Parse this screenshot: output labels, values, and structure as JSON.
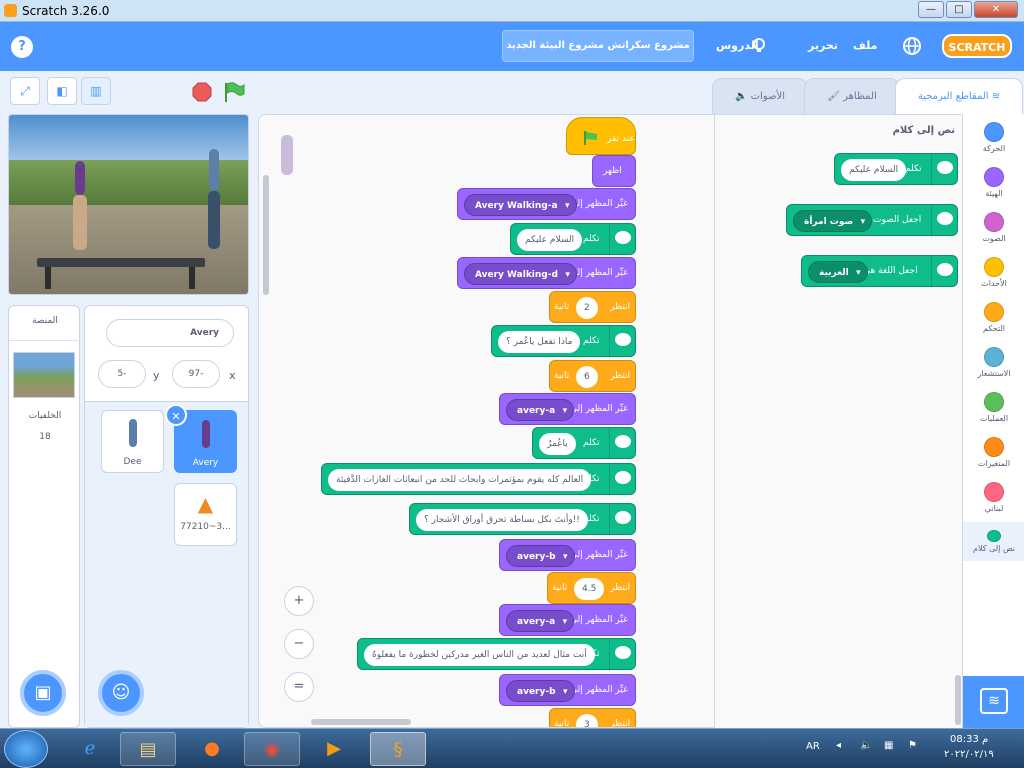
{
  "window": {
    "title": "Scratch 3.26.0",
    "minimize": "—",
    "maximize": "□",
    "close": "✕"
  },
  "menu": {
    "help": "?",
    "file": "ملف",
    "edit": "تحرير",
    "tutorials": "الدروس",
    "project_title": "مشروع سكراتش مشروع البيئة الجديد",
    "logo": "SCRATCH"
  },
  "tabs": {
    "code": "المقاطع البرمجية",
    "costumes": "المظاهر",
    "sounds": "الأصوات"
  },
  "palette": {
    "heading": "نص إلى كلام",
    "speak_label": "تكلم",
    "speak_value": "السلام عليكم",
    "voice_label": "اجعل الصوت",
    "voice_value": "صوت امرأة",
    "language_label": "اجعل اللغة هي",
    "language_value": "العربية"
  },
  "categories": [
    {
      "label": "الحركة",
      "color": "#4c97ff"
    },
    {
      "label": "الهيئة",
      "color": "#9966ff"
    },
    {
      "label": "الصوت",
      "color": "#cf63cf"
    },
    {
      "label": "الأحداث",
      "color": "#ffbf00"
    },
    {
      "label": "التحكم",
      "color": "#ffab19"
    },
    {
      "label": "الاستشعار",
      "color": "#5cb1d6"
    },
    {
      "label": "العمليات",
      "color": "#59c059"
    },
    {
      "label": "المتغيرات",
      "color": "#ff8c1a"
    },
    {
      "label": "لبناتي",
      "color": "#ff6680"
    },
    {
      "label": "نص إلى كلام",
      "color": "#0fbd8c"
    }
  ],
  "script": {
    "hat": "عند نقر",
    "show": "اظهر",
    "switch_costume": "غيِّر المظهر إلى",
    "speak": "تكلم",
    "wait": "انتظر",
    "seconds": "ثانية",
    "costume1": "Avery Walking-a",
    "say1": "السلام عليكم",
    "costume2": "Avery Walking-d",
    "wait1": "2",
    "say2": "ماذا تفعل ياعُمر ؟",
    "wait2": "6",
    "costume3": "avery-a",
    "say3": "ياعُمرُ",
    "say4": "العالم كله يقوم بمؤتمرات وابحاث للحد من انبعاثات الغازات الدَّفيئة",
    "say5": "وأنتَ بكل بساطة تحرق أوراق الأشجار ؟!!",
    "costume4": "avery-b",
    "wait3": "4.5",
    "costume5": "avery-a",
    "say6": "أنت مثال لعديد من الناس الغير مدركين لخطورة ما يفعلوهُ",
    "costume6": "avery-b",
    "wait4": "3"
  },
  "zoom": {
    "in": "+",
    "out": "−",
    "reset": "="
  },
  "sprite_info": {
    "name": "Avery",
    "x_label": "x",
    "x": "97-",
    "y_label": "y",
    "y": "5-"
  },
  "sprites": [
    {
      "name": "Avery",
      "selected": true
    },
    {
      "name": "Dee",
      "selected": false
    },
    {
      "name": "77210~3...",
      "selected": false
    }
  ],
  "stage_panel": {
    "title": "المنصة",
    "backdrops_label": "الخلفيات",
    "backdrops_count": "18"
  },
  "taskbar": {
    "lang": "AR",
    "time": "08:33 م",
    "date": "٢٠٢٢/٠٢/١٩"
  }
}
